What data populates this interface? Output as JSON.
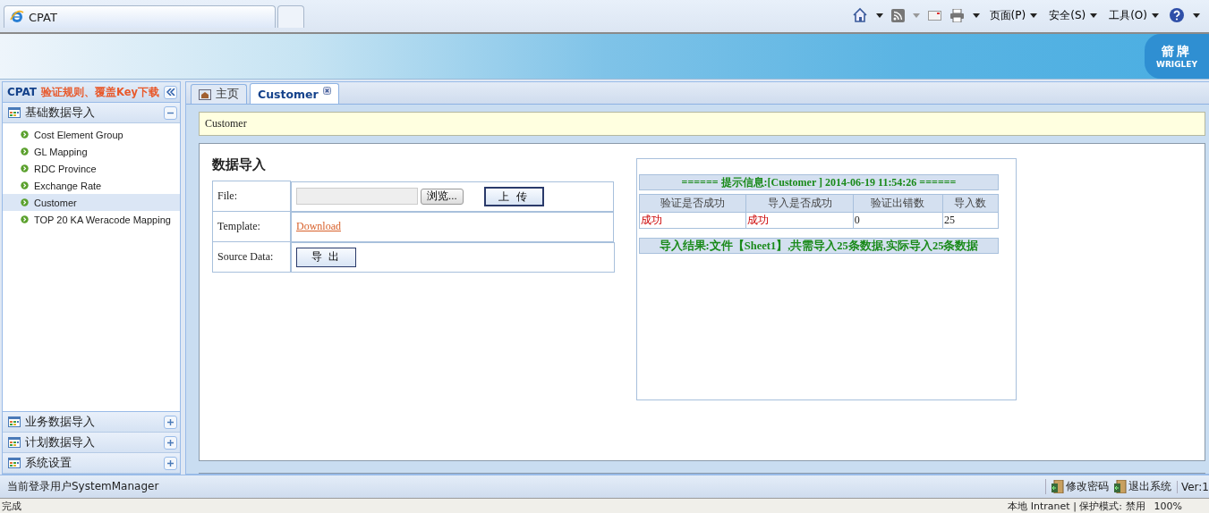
{
  "browser": {
    "tabs": [
      {
        "title": "CPAT",
        "selected": true
      }
    ],
    "menus": [
      "页面(P)",
      "安全(S)",
      "工具(O)"
    ]
  },
  "banner": {
    "logo_cn": "箭牌",
    "logo_en": "WRIGLEY"
  },
  "sidebar": {
    "title": "CPAT",
    "link": "验证规则、覆盖Key下载",
    "sections": [
      {
        "label": "基础数据导入",
        "expanded": true,
        "items": [
          {
            "label": "Cost Element Group",
            "selected": false
          },
          {
            "label": "GL Mapping",
            "selected": false
          },
          {
            "label": "RDC Province",
            "selected": false
          },
          {
            "label": "Exchange Rate",
            "selected": false
          },
          {
            "label": "Customer",
            "selected": true
          },
          {
            "label": "TOP 20 KA Weracode Mapping",
            "selected": false
          }
        ]
      },
      {
        "label": "业务数据导入",
        "expanded": false
      },
      {
        "label": "计划数据导入",
        "expanded": false
      },
      {
        "label": "系统设置",
        "expanded": false
      }
    ]
  },
  "tabs": [
    {
      "label": "主页",
      "selected": false,
      "closable": false
    },
    {
      "label": "Customer",
      "selected": true,
      "closable": true
    }
  ],
  "breadcrumb": "Customer",
  "form": {
    "title": "数据导入",
    "rows": [
      {
        "kind": "file",
        "label": "File:",
        "button": "浏览...",
        "action": "上 传"
      },
      {
        "kind": "link",
        "label": "Template:",
        "link": "Download"
      },
      {
        "kind": "button",
        "label": "Source Data:",
        "button": "导 出"
      }
    ]
  },
  "result": {
    "header": "====== 提示信息:[Customer ] 2014-06-19 11:54:26 ======",
    "columns": [
      "验证是否成功",
      "导入是否成功",
      "验证出错数",
      "导入数"
    ],
    "rows": [
      [
        {
          "text": "成功",
          "color": "#cc0000"
        },
        {
          "text": "成功",
          "color": "#cc0000"
        },
        {
          "text": "0"
        },
        {
          "text": "25"
        }
      ]
    ],
    "summary": "导入结果:文件【Sheet1】,共需导入25条数据,实际导入25条数据"
  },
  "footer": {
    "user": "当前登录用户SystemManager",
    "links": [
      "修改密码",
      "退出系统"
    ],
    "version": "Ver:1"
  },
  "ie_status": {
    "status": "完成",
    "zone": "本地 Intranet | 保护模式: 禁用",
    "zoom": "100%"
  }
}
